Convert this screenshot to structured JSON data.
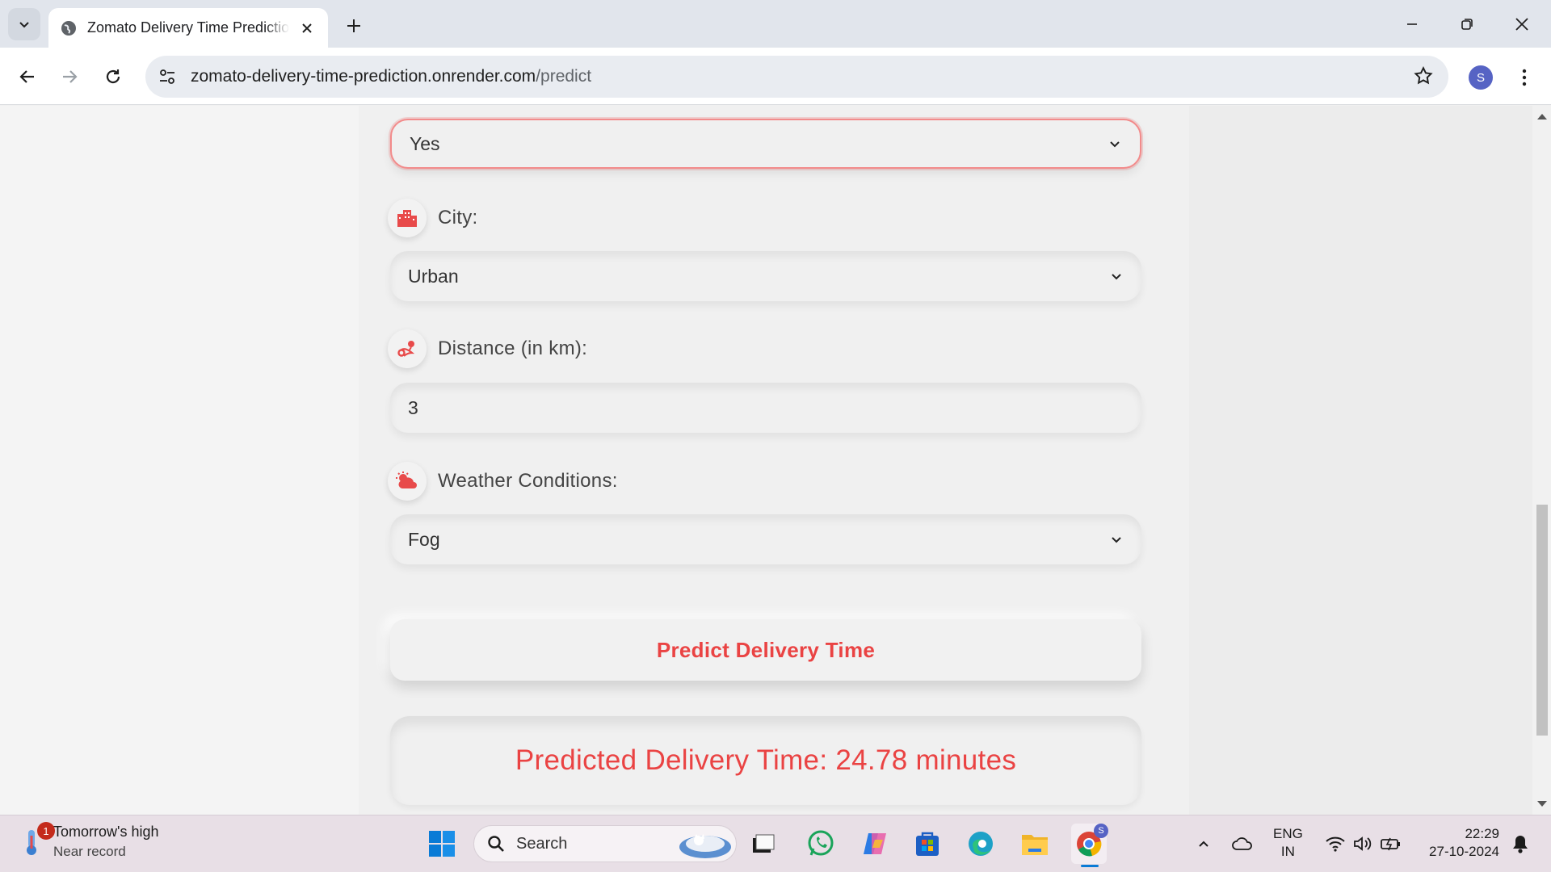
{
  "browser": {
    "tab_title": "Zomato Delivery Time Prediction",
    "url_domain": "zomato-delivery-time-prediction.onrender.com",
    "url_path": "/predict",
    "profile_initial": "S"
  },
  "form": {
    "festival_value": "Yes",
    "city_label": "City:",
    "city_value": "Urban",
    "distance_label": "Distance (in km):",
    "distance_value": "3",
    "weather_label": "Weather Conditions:",
    "weather_value": "Fog",
    "predict_button": "Predict Delivery Time",
    "result_text": "Predicted Delivery Time: 24.78 minutes"
  },
  "taskbar": {
    "weather_badge": "1",
    "weather_title": "Tomorrow's high",
    "weather_subtitle": "Near record",
    "search_label": "Search",
    "lang_line1": "ENG",
    "lang_line2": "IN",
    "time": "22:29",
    "date": "27-10-2024",
    "profile_badge": "S"
  },
  "colors": {
    "accent": "#ea4343",
    "page_bg": "#f0f0f0"
  }
}
